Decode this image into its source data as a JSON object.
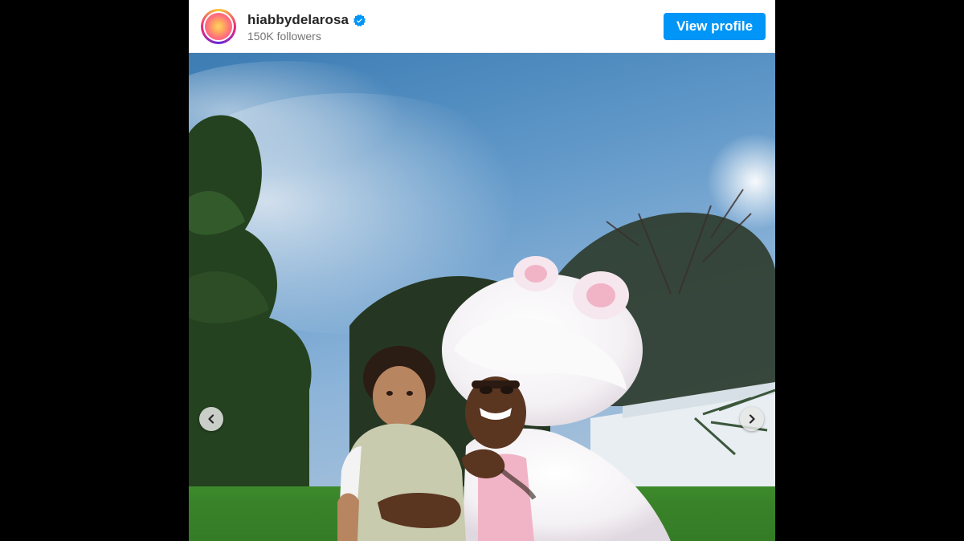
{
  "profile": {
    "username": "hiabbydelarosa",
    "followers": "150K followers",
    "verified": true
  },
  "header": {
    "view_profile_label": "View profile"
  },
  "icons": {
    "verified": "verified-badge-icon",
    "prev": "chevron-left-icon",
    "next": "chevron-right-icon"
  },
  "colors": {
    "accent": "#0095f6",
    "verified": "#0095f6",
    "background": "#000000"
  }
}
